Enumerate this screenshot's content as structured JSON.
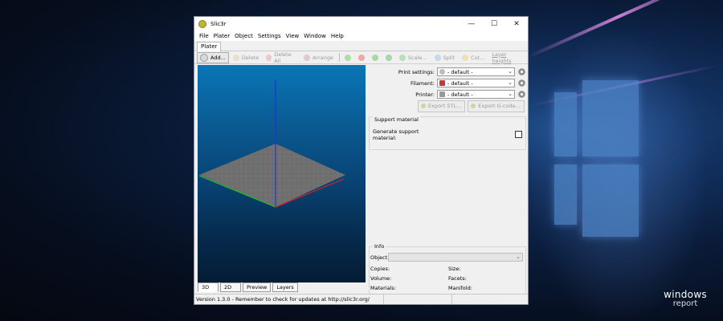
{
  "window": {
    "title": "Slic3r",
    "min_glyph": "—",
    "max_glyph": "☐",
    "close_glyph": "✕"
  },
  "menu": [
    "File",
    "Plater",
    "Object",
    "Settings",
    "View",
    "Window",
    "Help"
  ],
  "tab": "Plater",
  "toolbar": [
    "Add...",
    "Delete",
    "Delete All",
    "Arrange",
    "Scale...",
    "Split",
    "Cut...",
    "Layer heights"
  ],
  "settings": {
    "print_label": "Print settings:",
    "print_value": "- default -",
    "filament_label": "Filament:",
    "filament_value": "- default -",
    "printer_label": "Printer:",
    "printer_value": "- default -"
  },
  "export": {
    "stl": "Export STL...",
    "gcode": "Export G-code..."
  },
  "support": {
    "title": "Support material",
    "option": "Generate support material:"
  },
  "info": {
    "title": "Info",
    "object": "Object:",
    "copies": "Copies:",
    "size": "Size:",
    "volume": "Volume:",
    "facets": "Facets:",
    "materials": "Materials:",
    "manifold": "Manifold:"
  },
  "view_tabs": [
    "3D",
    "2D",
    "Preview",
    "Layers"
  ],
  "status": "Version 1.3.0 - Remember to check for updates at http://slic3r.org/",
  "brand": {
    "line1": "windows",
    "line2": "report"
  },
  "colors": {
    "viewport_top": "#0a76b6",
    "viewport_bottom": "#041c34",
    "x_axis": "#e02020",
    "y_axis": "#20c020",
    "z_axis": "#2030e0",
    "bed": "#6e6e6e"
  }
}
